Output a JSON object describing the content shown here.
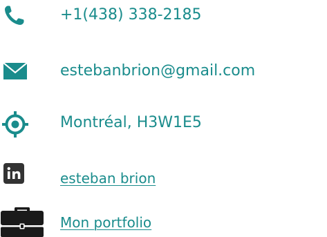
{
  "contacts": {
    "phone": {
      "icon": "phone-icon",
      "value": "+1(438) 338-2185"
    },
    "email": {
      "icon": "envelope-icon",
      "value": "estebanbrion@gmail.com"
    },
    "location": {
      "icon": "location-target-icon",
      "value": "Montréal, H3W1E5"
    },
    "linkedin": {
      "icon": "linkedin-icon",
      "value": "esteban brion"
    },
    "portfolio": {
      "icon": "briefcase-icon",
      "value": "Mon portfolio"
    }
  },
  "colors": {
    "accent": "#1a8c8c",
    "icon_dark": "#333333"
  }
}
